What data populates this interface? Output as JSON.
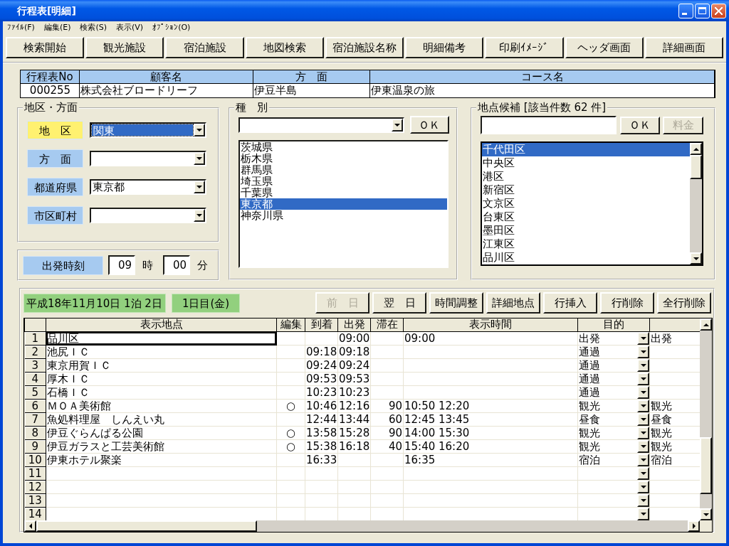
{
  "window": {
    "title": "行程表[明細]"
  },
  "menu": [
    {
      "label": "ﾌｧｲﾙ(F)"
    },
    {
      "label": "編集(E)"
    },
    {
      "label": "検索(S)"
    },
    {
      "label": "表示(V)"
    },
    {
      "label": "ｵﾌﾟｼｮﾝ(O)"
    }
  ],
  "toolbar": [
    "検索開始",
    "観光施設",
    "宿泊施設",
    "地図検索",
    "宿泊施設名称",
    "明細備考",
    "印刷ｲﾒｰｼﾞ",
    "ヘッダ画面",
    "詳細画面"
  ],
  "header": {
    "columns": [
      "行程表No",
      "顧客名",
      "方　面",
      "コース名"
    ],
    "values": [
      "000255",
      "株式会社ブロードリーフ",
      "伊豆半島",
      "伊東温泉の旅"
    ]
  },
  "area": {
    "title": "地区・方面",
    "fields": [
      {
        "label": "地　区",
        "value": "関東",
        "focused": true
      },
      {
        "label": "方　面",
        "focused": false
      },
      {
        "label": "都道府県",
        "value": "東京都",
        "focused": false
      },
      {
        "label": "市区町村",
        "focused": false
      }
    ]
  },
  "departure": {
    "label": "出発時刻",
    "hour": "09",
    "hour_unit": "時",
    "minute": "00",
    "minute_unit": "分"
  },
  "category": {
    "title": "種　別",
    "ok": "ＯＫ",
    "items": [
      {
        "label": "茨城県",
        "selected": false
      },
      {
        "label": "栃木県",
        "selected": false
      },
      {
        "label": "群馬県",
        "selected": false
      },
      {
        "label": "埼玉県",
        "selected": false
      },
      {
        "label": "千葉県",
        "selected": false
      },
      {
        "label": "東京都",
        "selected": true
      },
      {
        "label": "神奈川県",
        "selected": false
      }
    ]
  },
  "candidates": {
    "title": "地点候補 [該当件数 62 件]",
    "ok": "ＯＫ",
    "fee": {
      "label": "料金",
      "disabled": true
    },
    "items": [
      {
        "label": "千代田区",
        "selected": true
      },
      {
        "label": "中央区",
        "selected": false
      },
      {
        "label": "港区",
        "selected": false
      },
      {
        "label": "新宿区",
        "selected": false
      },
      {
        "label": "文京区",
        "selected": false
      },
      {
        "label": "台東区",
        "selected": false
      },
      {
        "label": "墨田区",
        "selected": false
      },
      {
        "label": "江東区",
        "selected": false
      },
      {
        "label": "品川区",
        "selected": false
      }
    ]
  },
  "day_bar": {
    "date": "平成18年11月10日 1泊 2日",
    "day": "1日目(金)",
    "buttons": [
      {
        "label": "前　日",
        "disabled": true
      },
      {
        "label": "翌　日",
        "disabled": false
      },
      {
        "label": "時間調整",
        "disabled": false
      },
      {
        "label": "詳細地点",
        "disabled": false
      },
      {
        "label": "行挿入",
        "disabled": false
      },
      {
        "label": "行削除",
        "disabled": false
      },
      {
        "label": "全行削除",
        "disabled": false
      }
    ]
  },
  "grid": {
    "columns": [
      "表示地点",
      "編集",
      "到着",
      "出発",
      "滞在",
      "表示時間",
      "目的"
    ],
    "rows": [
      {
        "number": "1",
        "place": "品川区",
        "focused": true,
        "departure": "09:00",
        "display_time": "09:00",
        "purpose": "出発",
        "column_8": "出発"
      },
      {
        "number": "2",
        "place": "池尻ＩＣ",
        "focused": false,
        "arrival": "09:18",
        "departure": "09:18",
        "purpose": "通過"
      },
      {
        "number": "3",
        "place": "東京用賀ＩＣ",
        "focused": false,
        "arrival": "09:24",
        "departure": "09:24",
        "purpose": "通過"
      },
      {
        "number": "4",
        "place": "厚木ＩＣ",
        "focused": false,
        "arrival": "09:53",
        "departure": "09:53",
        "purpose": "通過"
      },
      {
        "number": "5",
        "place": "石橋ＩＣ",
        "focused": false,
        "arrival": "10:23",
        "departure": "10:23",
        "purpose": "通過"
      },
      {
        "number": "6",
        "place": "ＭＯＡ美術館",
        "focused": false,
        "edit": "○",
        "arrival": "10:46",
        "departure": "12:16",
        "stay": "90",
        "display_time": "10:50 12:20",
        "purpose": "観光",
        "column_8": "観光"
      },
      {
        "number": "7",
        "place": "魚処料理屋　しんえい丸",
        "focused": false,
        "arrival": "12:44",
        "departure": "13:44",
        "stay": "60",
        "display_time": "12:45 13:45",
        "purpose": "昼食",
        "column_8": "昼食"
      },
      {
        "number": "8",
        "place": "伊豆ぐらんぱる公園",
        "focused": false,
        "edit": "○",
        "arrival": "13:58",
        "departure": "15:28",
        "stay": "90",
        "display_time": "14:00 15:30",
        "purpose": "観光",
        "column_8": "観光"
      },
      {
        "number": "9",
        "place": "伊豆ガラスと工芸美術館",
        "focused": false,
        "edit": "○",
        "arrival": "15:38",
        "departure": "16:18",
        "stay": "40",
        "display_time": "15:40 16:20",
        "purpose": "観光",
        "column_8": "観光"
      },
      {
        "number": "10",
        "place": "伊東ホテル聚楽",
        "focused": false,
        "arrival": "16:33",
        "display_time": "16:35",
        "purpose": "宿泊",
        "column_8": "宿泊"
      },
      {
        "number": "11",
        "focused": false
      },
      {
        "number": "12",
        "focused": false
      },
      {
        "number": "13",
        "focused": false
      },
      {
        "number": "14",
        "focused": false
      }
    ]
  }
}
